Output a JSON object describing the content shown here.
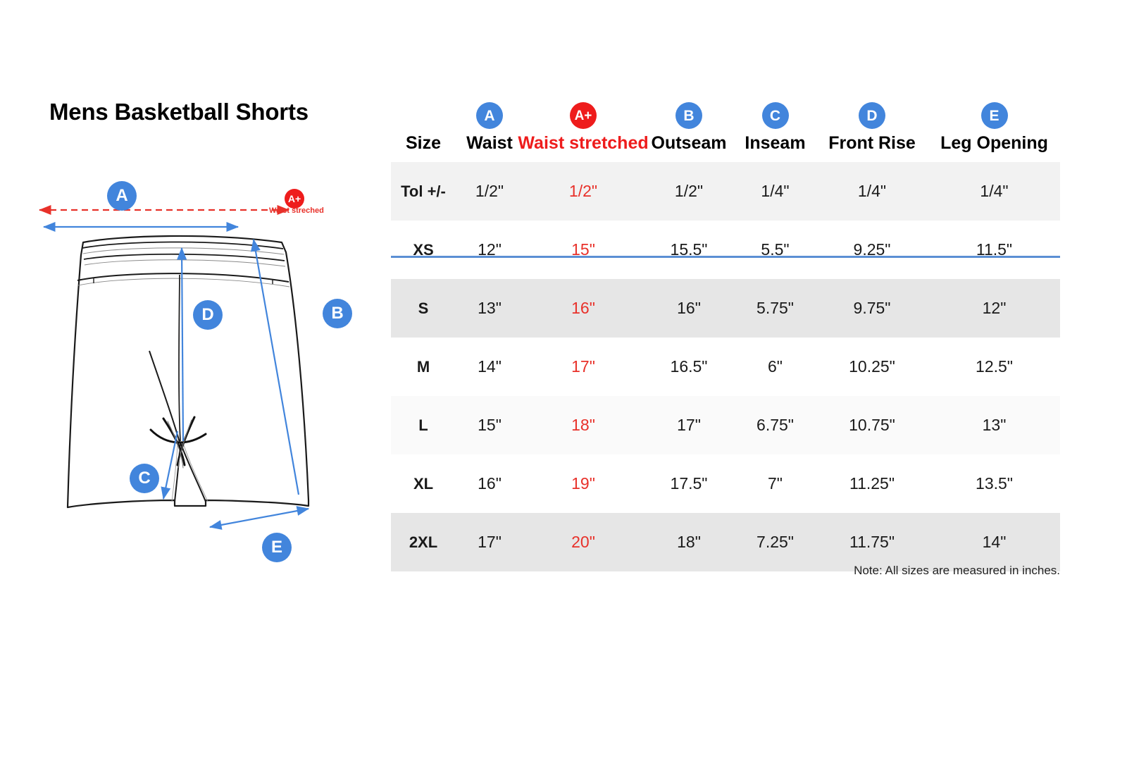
{
  "title": "Mens Basketball Shorts",
  "colors": {
    "badge_blue": "#4285DC",
    "badge_red": "#EE1C1C",
    "red_text": "#E8312A",
    "header_rule": "#5B8FD4",
    "arrow_blue": "#4285DC",
    "arrow_red": "#E8312A"
  },
  "diagram": {
    "badges": {
      "a": "A",
      "b": "B",
      "c": "C",
      "d": "D",
      "e": "E",
      "a_plus": "A+"
    },
    "waist_stretched_label": "Waist streched"
  },
  "table": {
    "headers": [
      {
        "badge": "",
        "label": "Size",
        "red": false
      },
      {
        "badge": "A",
        "label": "Waist",
        "red": false
      },
      {
        "badge": "A+",
        "label": "Waist stretched",
        "red": true
      },
      {
        "badge": "B",
        "label": "Outseam",
        "red": false
      },
      {
        "badge": "C",
        "label": "Inseam",
        "red": false
      },
      {
        "badge": "D",
        "label": "Front Rise",
        "red": false
      },
      {
        "badge": "E",
        "label": "Leg Opening",
        "red": false
      }
    ],
    "rows": [
      {
        "size": "Tol +/-",
        "waist": "1/2\"",
        "waist_stretched": "1/2\"",
        "outseam": "1/2\"",
        "inseam": "1/4\"",
        "front_rise": "1/4\"",
        "leg_opening": "1/4\"",
        "shade": "mid"
      },
      {
        "size": "XS",
        "waist": "12\"",
        "waist_stretched": "15\"",
        "outseam": "15.5\"",
        "inseam": "5.5\"",
        "front_rise": "9.25\"",
        "leg_opening": "11.5\"",
        "shade": "none"
      },
      {
        "size": "S",
        "waist": "13\"",
        "waist_stretched": "16\"",
        "outseam": "16\"",
        "inseam": "5.75\"",
        "front_rise": "9.75\"",
        "leg_opening": "12\"",
        "shade": "dark"
      },
      {
        "size": "M",
        "waist": "14\"",
        "waist_stretched": "17\"",
        "outseam": "16.5\"",
        "inseam": "6\"",
        "front_rise": "10.25\"",
        "leg_opening": "12.5\"",
        "shade": "none"
      },
      {
        "size": "L",
        "waist": "15\"",
        "waist_stretched": "18\"",
        "outseam": "17\"",
        "inseam": "6.75\"",
        "front_rise": "10.75\"",
        "leg_opening": "13\"",
        "shade": "light"
      },
      {
        "size": "XL",
        "waist": "16\"",
        "waist_stretched": "19\"",
        "outseam": "17.5\"",
        "inseam": "7\"",
        "front_rise": "11.25\"",
        "leg_opening": "13.5\"",
        "shade": "none"
      },
      {
        "size": "2XL",
        "waist": "17\"",
        "waist_stretched": "20\"",
        "outseam": "18\"",
        "inseam": "7.25\"",
        "front_rise": "11.75\"",
        "leg_opening": "14\"",
        "shade": "dark"
      }
    ],
    "note": "Note: All sizes are measured in inches."
  }
}
